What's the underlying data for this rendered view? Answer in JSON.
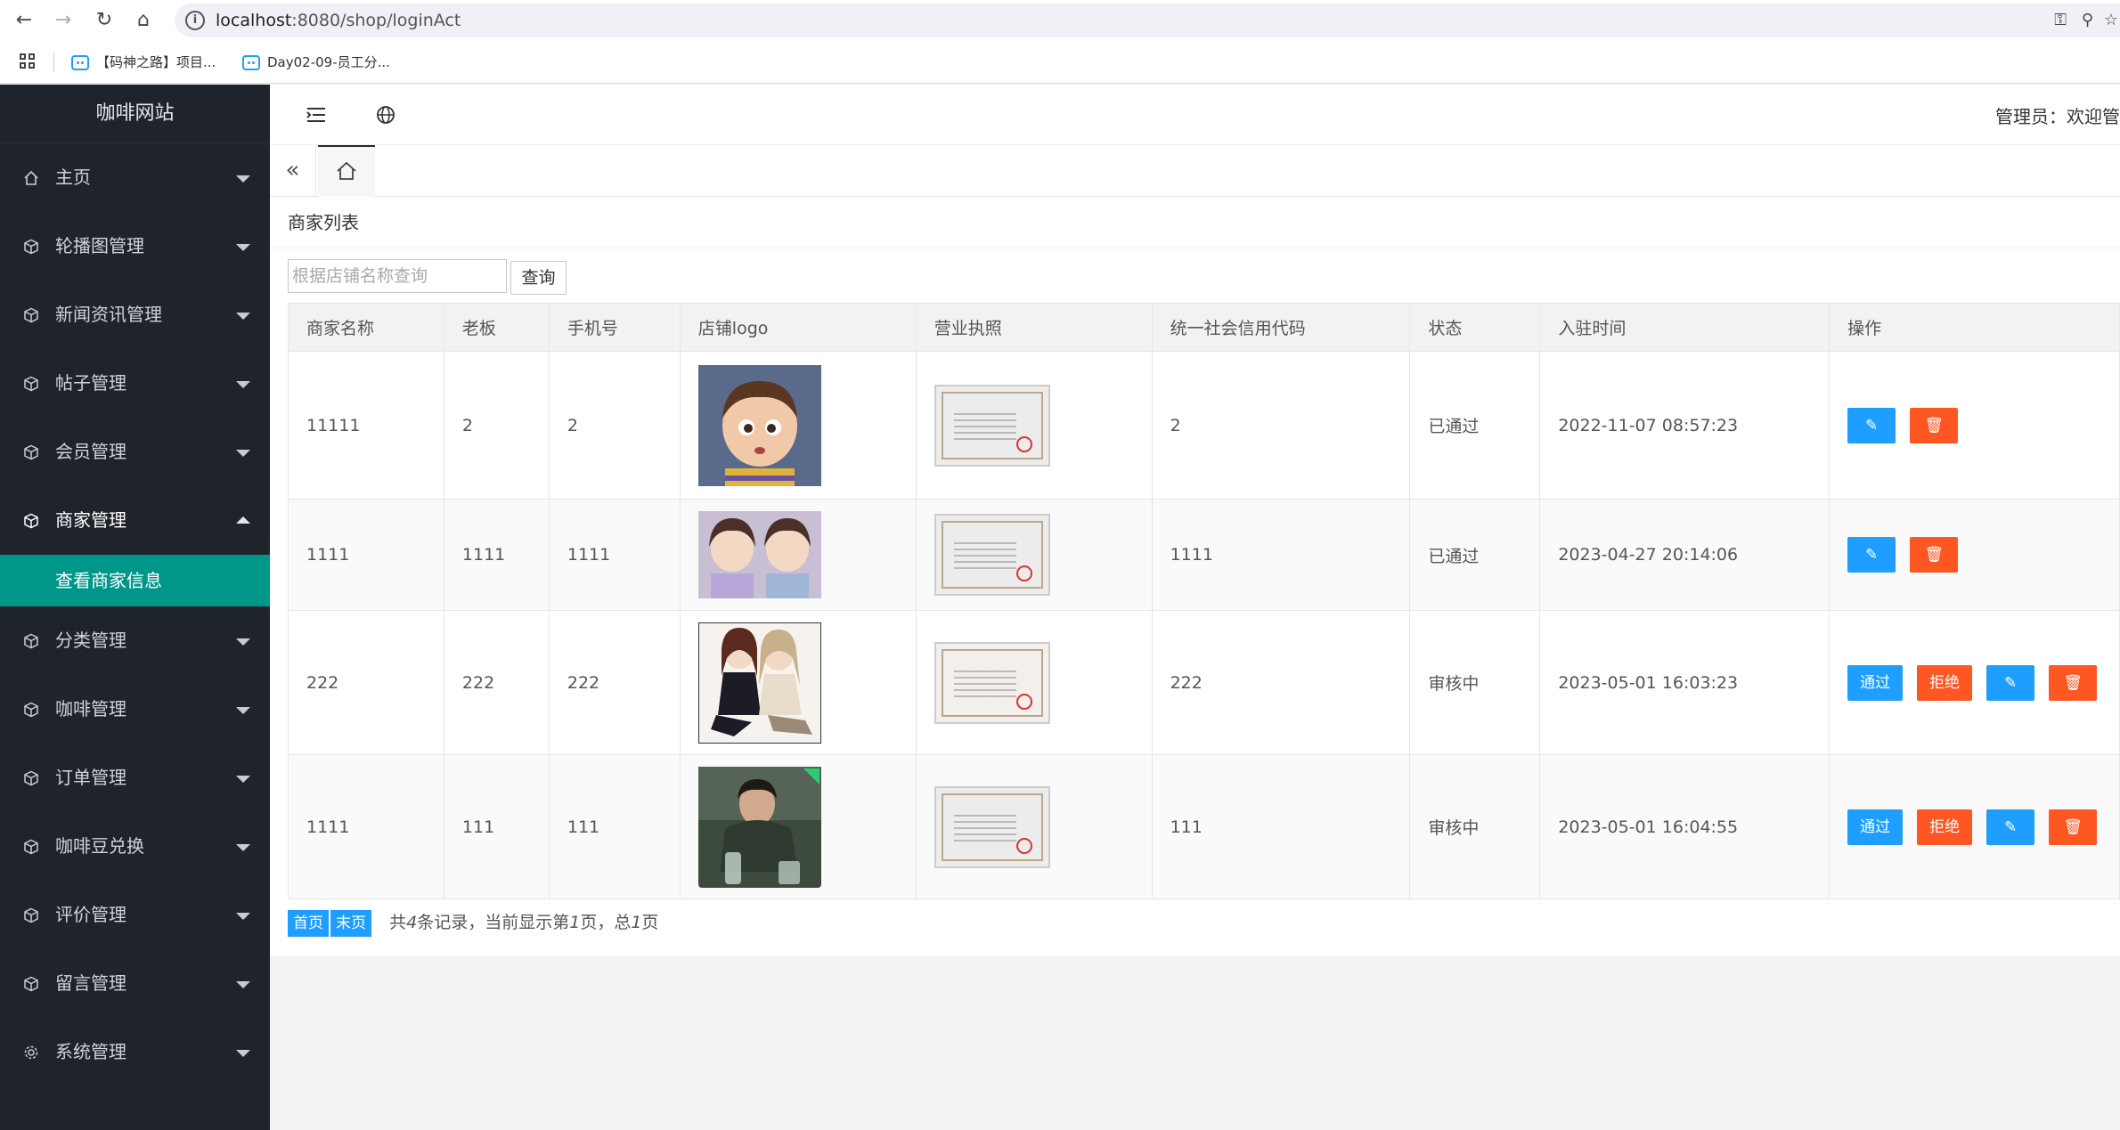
{
  "browser": {
    "url_host": "localhost",
    "url_rest": ":8080/shop/loginAct",
    "bookmarks": [
      {
        "label": "【码神之路】项目..."
      },
      {
        "label": "Day02-09-员工分..."
      }
    ]
  },
  "sidebar": {
    "title": "咖啡网站",
    "items": [
      {
        "label": "主页",
        "icon": "home-icon"
      },
      {
        "label": "轮播图管理",
        "icon": "cube-icon"
      },
      {
        "label": "新闻资讯管理",
        "icon": "cube-icon"
      },
      {
        "label": "帖子管理",
        "icon": "cube-icon"
      },
      {
        "label": "会员管理",
        "icon": "cube-icon"
      },
      {
        "label": "商家管理",
        "icon": "cube-icon"
      },
      {
        "label": "分类管理",
        "icon": "cube-icon"
      },
      {
        "label": "咖啡管理",
        "icon": "cube-icon"
      },
      {
        "label": "订单管理",
        "icon": "cube-icon"
      },
      {
        "label": "咖啡豆兑换",
        "icon": "cube-icon"
      },
      {
        "label": "评价管理",
        "icon": "cube-icon"
      },
      {
        "label": "留言管理",
        "icon": "cube-icon"
      },
      {
        "label": "系统管理",
        "icon": "gear-icon"
      }
    ],
    "active_sub": "查看商家信息"
  },
  "header": {
    "admin_text": "管理员：欢迎管"
  },
  "content": {
    "title": "商家列表",
    "search_placeholder": "根据店铺名称查询",
    "search_button": "查询",
    "columns": [
      "商家名称",
      "老板",
      "手机号",
      "店铺logo",
      "营业执照",
      "统一社会信用代码",
      "状态",
      "入驻时间",
      "操作"
    ],
    "rows": [
      {
        "name": "11111",
        "boss": "2",
        "phone": "2",
        "code": "2",
        "status": "已通过",
        "time": "2022-11-07 08:57:23"
      },
      {
        "name": "1111",
        "boss": "1111",
        "phone": "1111",
        "code": "1111",
        "status": "已通过",
        "time": "2023-04-27 20:14:06"
      },
      {
        "name": "222",
        "boss": "222",
        "phone": "222",
        "code": "222",
        "status": "审核中",
        "time": "2023-05-01 16:03:23"
      },
      {
        "name": "1111",
        "boss": "111",
        "phone": "111",
        "code": "111",
        "status": "审核中",
        "time": "2023-05-01 16:04:55"
      }
    ],
    "approve_label": "通过",
    "reject_label": "拒绝"
  },
  "pager": {
    "first": "首页",
    "last": "末页",
    "info_a": "共",
    "total": "4",
    "info_b": "条记录，当前显示第",
    "current": "1",
    "info_c": "页，总",
    "pages": "1",
    "info_d": "页"
  },
  "colors": {
    "sidebar_bg": "#1f232b",
    "active_teal": "#009688",
    "btn_blue": "#1e9fff",
    "btn_red": "#ff5722"
  }
}
